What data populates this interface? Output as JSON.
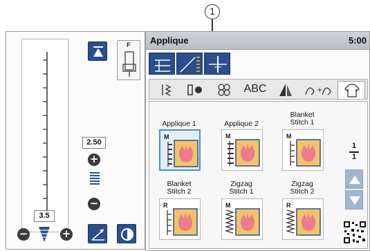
{
  "callout": {
    "number": "1"
  },
  "left_panel": {
    "foot_letter": "F",
    "stitch_width": "2.50",
    "stitch_length": "3.5",
    "plus_symbol": "+",
    "minus_symbol": "−"
  },
  "header": {
    "title": "Applique",
    "time": "5:00"
  },
  "tabs": [
    {
      "label": "",
      "icon": "straight-stitch-tab-icon"
    },
    {
      "label": "",
      "icon": "satin-stitch-tab-icon"
    },
    {
      "label": "",
      "icon": "decorative-stitch-tab-icon"
    },
    {
      "label": "ABC",
      "icon": ""
    },
    {
      "label": "",
      "icon": "quilt-tab-icon"
    },
    {
      "label": "",
      "icon": "floral-tab-icon"
    },
    {
      "label": "",
      "icon": "shirt-tab-icon"
    }
  ],
  "stitches": [
    {
      "label_line1": "Applique 1",
      "label_line2": "",
      "letter": "M",
      "selected": true
    },
    {
      "label_line1": "Applique 2",
      "label_line2": "",
      "letter": "M",
      "selected": false
    },
    {
      "label_line1": "Blanket",
      "label_line2": "Stitch 1",
      "letter": "M",
      "selected": false
    },
    {
      "label_line1": "Blanket",
      "label_line2": "Stitch 2",
      "letter": "R",
      "selected": false
    },
    {
      "label_line1": "Zigzag",
      "label_line2": "Stitch 1",
      "letter": "M",
      "selected": false
    },
    {
      "label_line1": "Zigzag",
      "label_line2": "Stitch 2",
      "letter": "R",
      "selected": false
    }
  ],
  "page_indicator": {
    "current": "1",
    "total": "1"
  },
  "colors": {
    "button_blue": "#2a4f8c",
    "select_blue": "#4a8ec9",
    "tulip_pink": "#ec7b8d",
    "tile_bg": "#f0c56a"
  }
}
